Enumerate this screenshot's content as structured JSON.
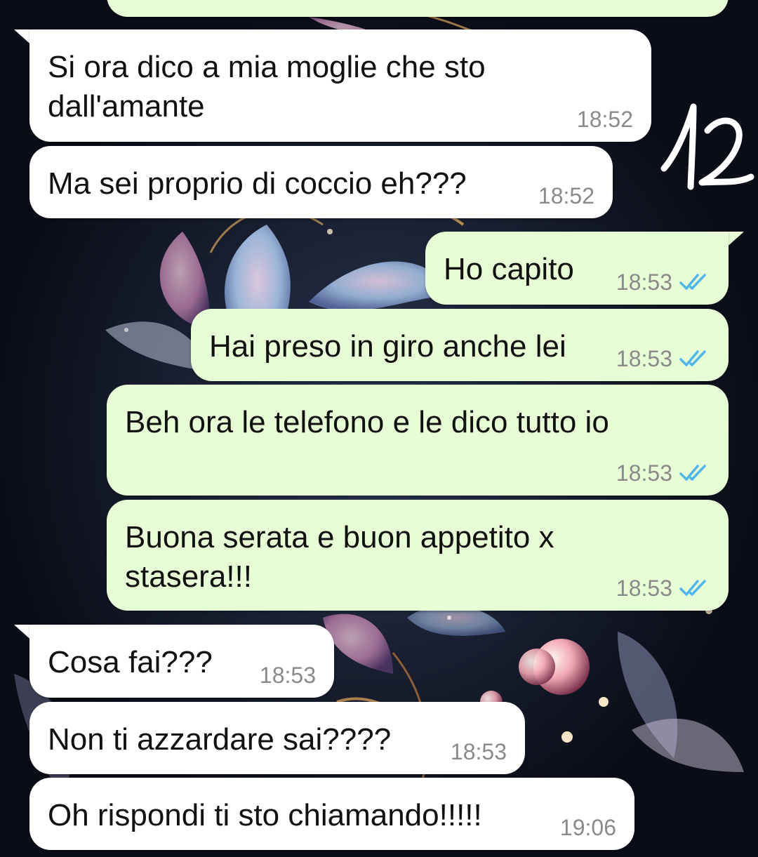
{
  "conversation": {
    "messages": [
      {
        "direction": "incoming",
        "text": "Si ora dico a mia moglie che sto\ndall'amante",
        "time": "18:52"
      },
      {
        "direction": "incoming",
        "text": "Ma sei proprio di coccio eh???",
        "time": "18:52"
      },
      {
        "direction": "outgoing",
        "text": "Ho capito",
        "time": "18:53",
        "status": "read"
      },
      {
        "direction": "outgoing",
        "text": "Hai preso in giro anche lei",
        "time": "18:53",
        "status": "read"
      },
      {
        "direction": "outgoing",
        "text": "Beh ora le telefono e le dico tutto io",
        "time": "18:53",
        "status": "read"
      },
      {
        "direction": "outgoing",
        "text": "Buona serata e buon appetito x\nstasera!!!",
        "time": "18:53",
        "status": "read"
      },
      {
        "direction": "incoming",
        "text": "Cosa fai???",
        "time": "18:53"
      },
      {
        "direction": "incoming",
        "text": "Non ti azzardare sai????",
        "time": "18:53"
      },
      {
        "direction": "incoming",
        "text": "Oh rispondi ti sto chiamando!!!!!",
        "time": "19:06"
      }
    ]
  },
  "annotation": {
    "handwritten_number": "12"
  },
  "colors": {
    "incoming_bubble": "#ffffff",
    "outgoing_bubble": "#e7fdd6",
    "read_ticks": "#4fb6ec",
    "timestamp": "#8a8a8a"
  },
  "icons": {
    "read_status": "double-check-icon",
    "wallpaper": "floral-wallpaper"
  }
}
